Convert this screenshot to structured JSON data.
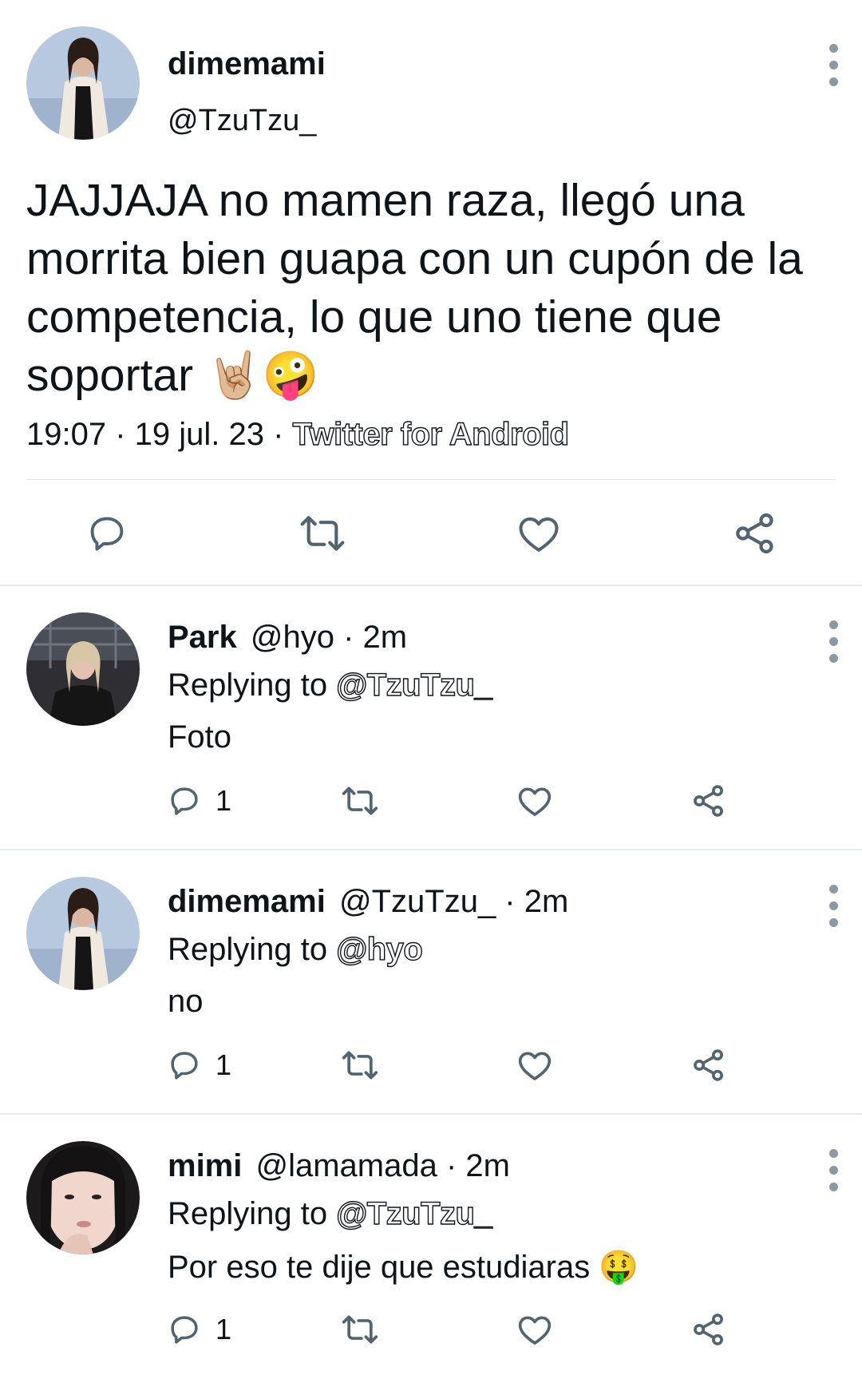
{
  "main_tweet": {
    "display_name": "dimemami",
    "handle": "@TzuTzu_",
    "text": "JAJJAJA no mamen raza, llegó una morrita bien guapa con un cupón de la competencia, lo que uno tiene que soportar",
    "emojis": "🤘🏼🤪",
    "time": "19:07 · 19 jul. 23 · ",
    "source": "Twitter for Android"
  },
  "replies": [
    {
      "display_name": "Park",
      "meta": "@hyo · 2m",
      "replying_prefix": "Replying to ",
      "replying_to": "@TzuTzu_",
      "text": "Foto",
      "reply_count": "1"
    },
    {
      "display_name": "dimemami",
      "meta": "@TzuTzu_ · 2m",
      "replying_prefix": "Replying to ",
      "replying_to": "@hyo",
      "text": "no",
      "reply_count": "1"
    },
    {
      "display_name": "mimi",
      "meta": "@lamamada · 2m",
      "replying_prefix": "Replying to ",
      "replying_to": "@TzuTzu_",
      "text": "Por eso te dije que estudiaras 🤑",
      "reply_count": "1"
    }
  ],
  "icons": [
    "reply-icon",
    "retweet-icon",
    "like-icon",
    "share-icon",
    "more-icon"
  ],
  "colors": {
    "icon_gray": "#536471",
    "divider": "#e7ecf0",
    "text": "#0f1419"
  }
}
